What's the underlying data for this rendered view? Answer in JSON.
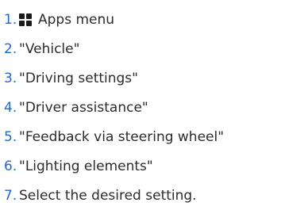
{
  "steps": [
    {
      "number": "1.",
      "text": "Apps menu",
      "icon": "apps-grid-icon"
    },
    {
      "number": "2.",
      "text": "\"Vehicle\""
    },
    {
      "number": "3.",
      "text": "\"Driving settings\""
    },
    {
      "number": "4.",
      "text": "\"Driver assistance\""
    },
    {
      "number": "5.",
      "text": "\"Feedback via steering wheel\""
    },
    {
      "number": "6.",
      "text": "\"Lighting elements\""
    },
    {
      "number": "7.",
      "text": "Select the desired setting."
    }
  ],
  "colors": {
    "number": "#1c69d4",
    "text": "#2b2b2b",
    "icon": "#1a1a1a"
  }
}
